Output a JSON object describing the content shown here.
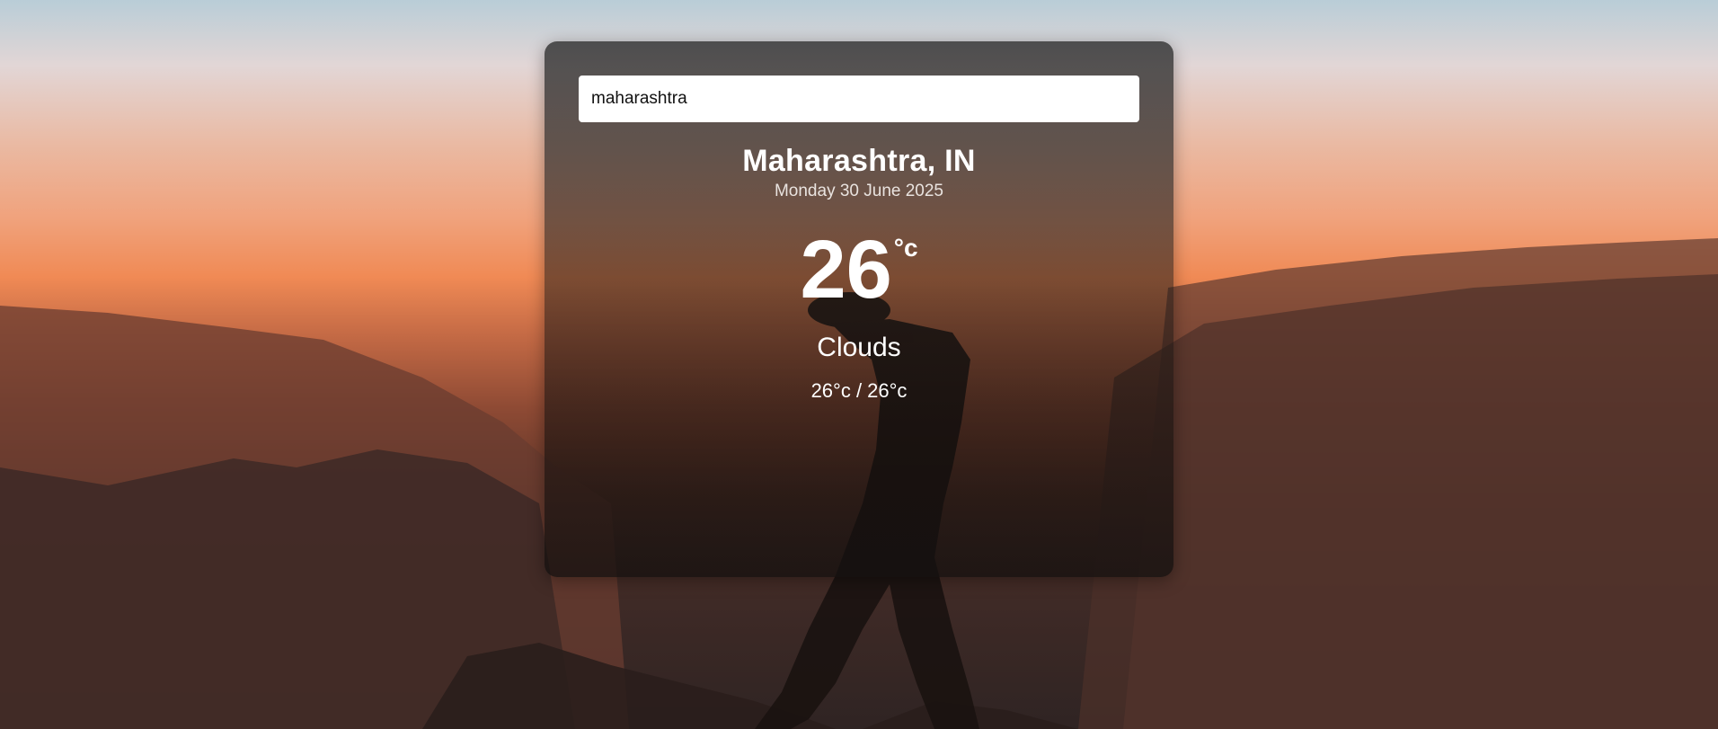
{
  "search": {
    "value": "maharashtra"
  },
  "weather": {
    "location": "Maharashtra, IN",
    "date": "Monday 30 June 2025",
    "temperature": "26",
    "unit": "°c",
    "condition": "Clouds",
    "hi_lo": "26°c / 26°c"
  },
  "colors": {
    "card": "#2b2b2b",
    "text": "#ffffff",
    "sunset": "#f08a55"
  }
}
